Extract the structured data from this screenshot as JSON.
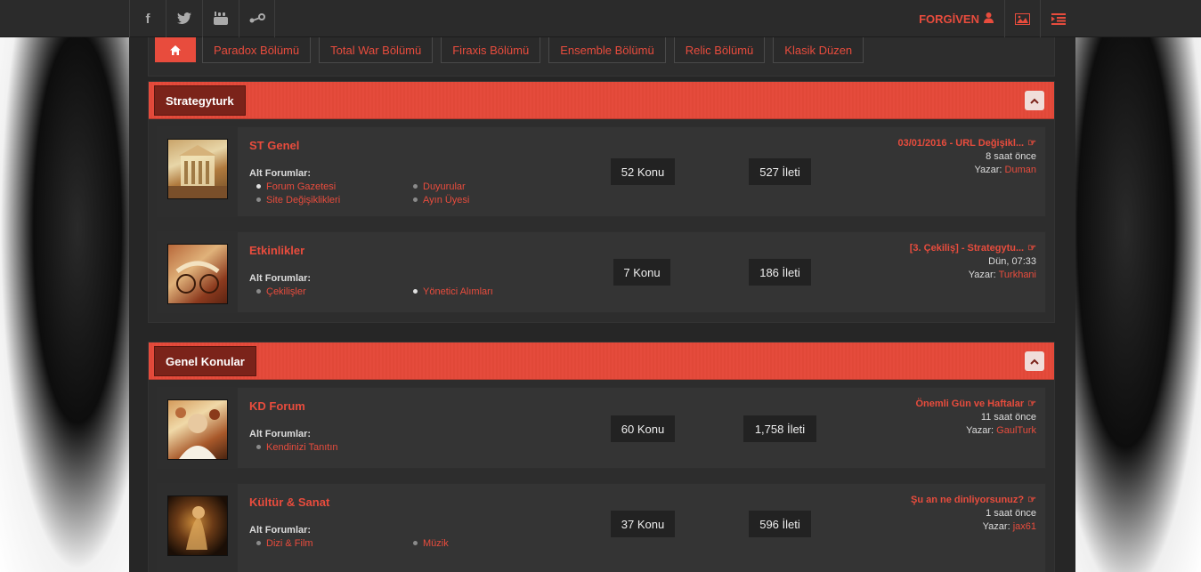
{
  "topbar": {
    "social": [
      {
        "name": "facebook-icon",
        "glyph": "f"
      },
      {
        "name": "twitter-icon",
        "glyph": "🐦"
      },
      {
        "name": "youtube-icon",
        "glyph": "▶"
      },
      {
        "name": "steam-icon",
        "glyph": "⚙"
      }
    ],
    "username": "FORGİVEN",
    "user_icon": "user-icon",
    "gallery_icon": "image-icon",
    "menu_icon": "sidebar-toggle-icon"
  },
  "nav": {
    "home_icon": "home-icon",
    "tabs": [
      "Paradox Bölümü",
      "Total War Bölümü",
      "Firaxis Bölümü",
      "Ensemble Bölümü",
      "Relic Bölümü",
      "Klasik Düzen"
    ]
  },
  "categories": [
    {
      "title": "Strategyturk",
      "toggle": "^",
      "forums": [
        {
          "title": "ST Genel",
          "sub_label": "Alt Forumlar:",
          "subforums": [
            "Forum Gazetesi",
            "Duyurular",
            "Site Değişiklikleri",
            "Ayın Üyesi"
          ],
          "topics": "52 Konu",
          "posts": "527 İleti",
          "last_title": "03/01/2016 - URL Değişikl...",
          "last_time": "8 saat önce",
          "author_label": "Yazar:",
          "author": "Duman"
        },
        {
          "title": "Etkinlikler",
          "sub_label": "Alt Forumlar:",
          "subforums": [
            "Çekilişler",
            "Yönetici Alımları"
          ],
          "topics": "7 Konu",
          "posts": "186 İleti",
          "last_title": "[3. Çekiliş] - Strategytu...",
          "last_time": "Dün, 07:33",
          "author_label": "Yazar:",
          "author": "Turkhani"
        }
      ]
    },
    {
      "title": "Genel Konular",
      "toggle": "^",
      "forums": [
        {
          "title": "KD Forum",
          "sub_label": "Alt Forumlar:",
          "subforums": [
            "Kendinizi Tanıtın"
          ],
          "topics": "60 Konu",
          "posts": "1,758 İleti",
          "last_title": "Önemli Gün ve Haftalar",
          "last_time": "11 saat önce",
          "author_label": "Yazar:",
          "author": "GaulTurk"
        },
        {
          "title": "Kültür & Sanat",
          "sub_label": "Alt Forumlar:",
          "subforums": [
            "Dizi & Film",
            "Müzik"
          ],
          "topics": "37 Konu",
          "posts": "596 İleti",
          "last_title": "Şu an ne dinliyorsunuz?",
          "last_time": "1 saat önce",
          "author_label": "Yazar:",
          "author": "jax61"
        }
      ]
    }
  ],
  "colors": {
    "accent": "#e84c3d",
    "panel": "#2d2d2d",
    "header_title_bg": "#7b231a"
  }
}
